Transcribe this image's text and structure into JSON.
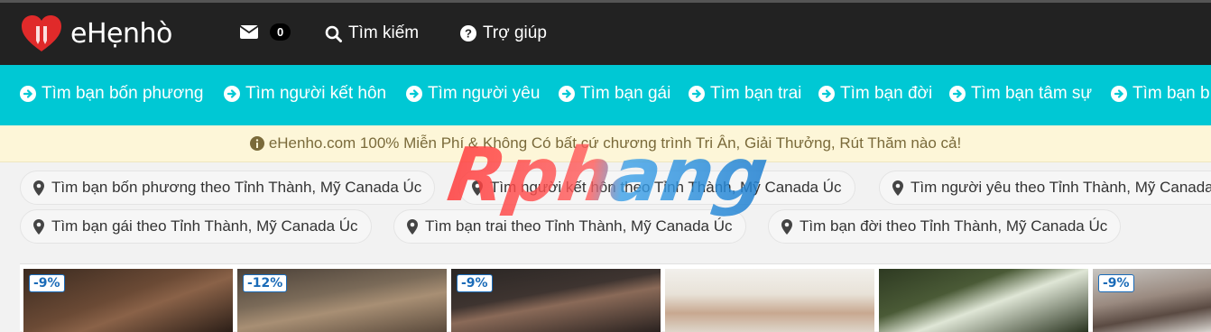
{
  "header": {
    "logo_text": "eHẹnhò",
    "mail_count": "0",
    "search_label": "Tìm kiếm",
    "help_label": "Trợ giúp"
  },
  "categories": [
    "Tìm bạn bốn phương",
    "Tìm người kết hôn",
    "Tìm người yêu",
    "Tìm bạn gái",
    "Tìm bạn trai",
    "Tìm bạn đời",
    "Tìm bạn tâm sự",
    "Tìm bạn b"
  ],
  "notice": {
    "text": "eHenho.com 100% Miễn Phí & Không Có bất cứ chương trình Tri Ân, Giải Thưởng, Rút Thăm nào cả!"
  },
  "location_pills": [
    "Tìm bạn bốn phương theo Tỉnh Thành, Mỹ Canada Úc",
    "Tìm người kết hôn theo Tỉnh Thành, Mỹ Canada Úc",
    "Tìm người yêu theo Tỉnh Thành, Mỹ Canada Úc",
    "Tìm bạn gái theo Tỉnh Thành, Mỹ Canada Úc",
    "Tìm bạn trai theo Tỉnh Thành, Mỹ Canada Úc",
    "Tìm bạn đời theo Tỉnh Thành, Mỹ Canada Úc"
  ],
  "photos": [
    {
      "badge": "-9%"
    },
    {
      "badge": "-12%"
    },
    {
      "badge": "-9%"
    },
    {
      "badge": ""
    },
    {
      "badge": ""
    },
    {
      "badge": "-9%"
    }
  ],
  "watermark": {
    "text": "Rphang"
  },
  "colors": {
    "topbar": "#222222",
    "catbar": "#00c8d4",
    "notice_bg": "#fdf6d8",
    "badge_text": "#1a6bb8"
  }
}
